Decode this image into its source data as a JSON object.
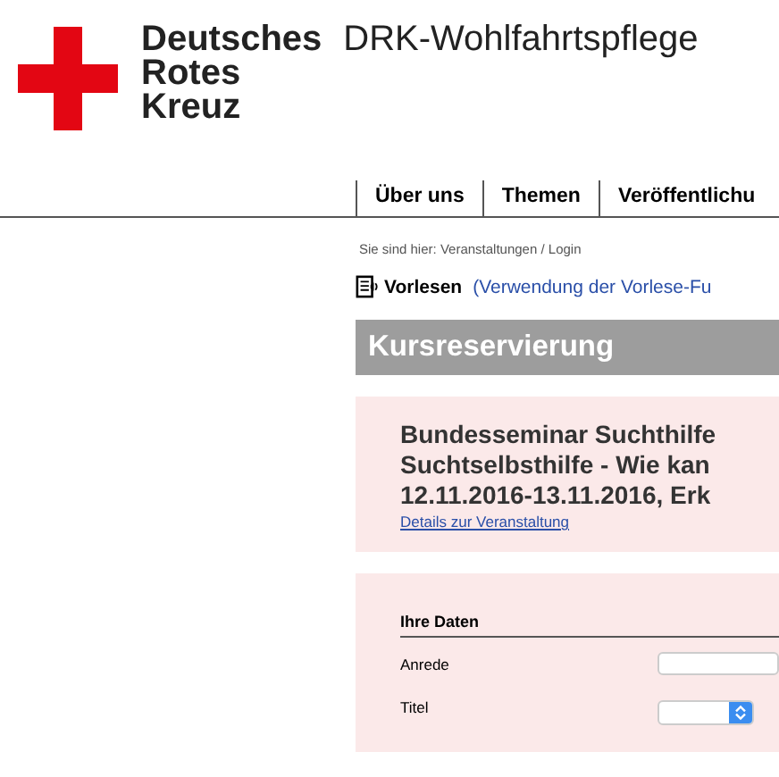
{
  "logo": {
    "lines": [
      "Deutsches",
      "Rotes",
      "Kreuz"
    ]
  },
  "site_title": "DRK-Wohlfahrtspflege",
  "nav": [
    {
      "label": "Über uns"
    },
    {
      "label": "Themen"
    },
    {
      "label": "Veröffentlichu"
    }
  ],
  "breadcrumb": "Sie sind hier: Veranstaltungen / Login",
  "read_aloud": {
    "label": "Vorlesen",
    "link": "(Verwendung der Vorlese-Fu"
  },
  "heading": "Kursreservierung",
  "event": {
    "lines": [
      "Bundesseminar Suchthilfe",
      "Suchtselbsthilfe - Wie kan",
      "12.11.2016-13.11.2016, Erk"
    ],
    "link": "Details zur Veranstaltung"
  },
  "form": {
    "section": "Ihre Daten",
    "fields": [
      {
        "label": "Anrede",
        "kind": "text"
      },
      {
        "label": "Titel",
        "kind": "select"
      }
    ]
  }
}
